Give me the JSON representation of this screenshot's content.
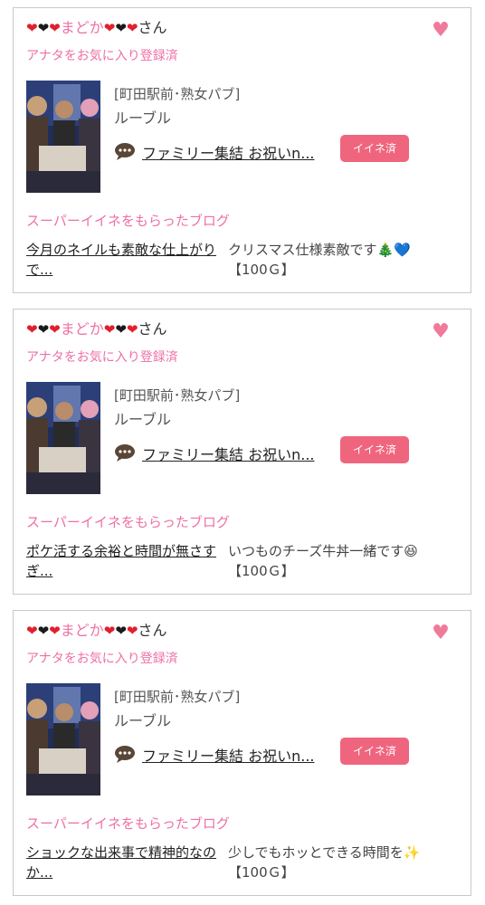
{
  "cards": [
    {
      "user": {
        "hearts": [
          "❤",
          "❤",
          "❤"
        ],
        "name": "まどか",
        "hearts_after": [
          "❤",
          "❤",
          "❤"
        ],
        "suffix": "さん"
      },
      "fav_status": "アナタをお気に入り登録済",
      "shop": {
        "area": "[町田駅前･熟女パブ]",
        "name": "ルーブル"
      },
      "blog_title": "ファミリー集結 お祝いn...",
      "iine_label": "イイネ済",
      "super_heading": "スーパーイイネをもらったブログ",
      "my_blog_title": "今月のネイルも素敵な仕上がりで...",
      "comment": "クリスマス仕様素敵です🎄💙",
      "points": "【100Ｇ】"
    },
    {
      "user": {
        "hearts": [
          "❤",
          "❤",
          "❤"
        ],
        "name": "まどか",
        "hearts_after": [
          "❤",
          "❤",
          "❤"
        ],
        "suffix": "さん"
      },
      "fav_status": "アナタをお気に入り登録済",
      "shop": {
        "area": "[町田駅前･熟女パブ]",
        "name": "ルーブル"
      },
      "blog_title": "ファミリー集結 お祝いn...",
      "iine_label": "イイネ済",
      "super_heading": "スーパーイイネをもらったブログ",
      "my_blog_title": "ポケ活する余裕と時間が無さすぎ...",
      "comment": "いつものチーズ牛丼一緒です😆",
      "points": "【100Ｇ】"
    },
    {
      "user": {
        "hearts": [
          "❤",
          "❤",
          "❤"
        ],
        "name": "まどか",
        "hearts_after": [
          "❤",
          "❤",
          "❤"
        ],
        "suffix": "さん"
      },
      "fav_status": "アナタをお気に入り登録済",
      "shop": {
        "area": "[町田駅前･熟女パブ]",
        "name": "ルーブル"
      },
      "blog_title": "ファミリー集結 お祝いn...",
      "iine_label": "イイネ済",
      "super_heading": "スーパーイイネをもらったブログ",
      "my_blog_title": "ショックな出来事で精神的なのか...",
      "comment": "少しでもホッとできる時間を✨",
      "points": "【100Ｇ】"
    }
  ],
  "colors": {
    "pink_text": "#ef6fa5",
    "badge_bg": "#f0657e",
    "heart_button": "#f07a9a",
    "heart_red": "#e0202e",
    "heart_black": "#1a1a1a",
    "border": "#c9c9c9"
  },
  "icons": {
    "favorite": "heart-icon",
    "comment": "speech-bubble-icon"
  }
}
